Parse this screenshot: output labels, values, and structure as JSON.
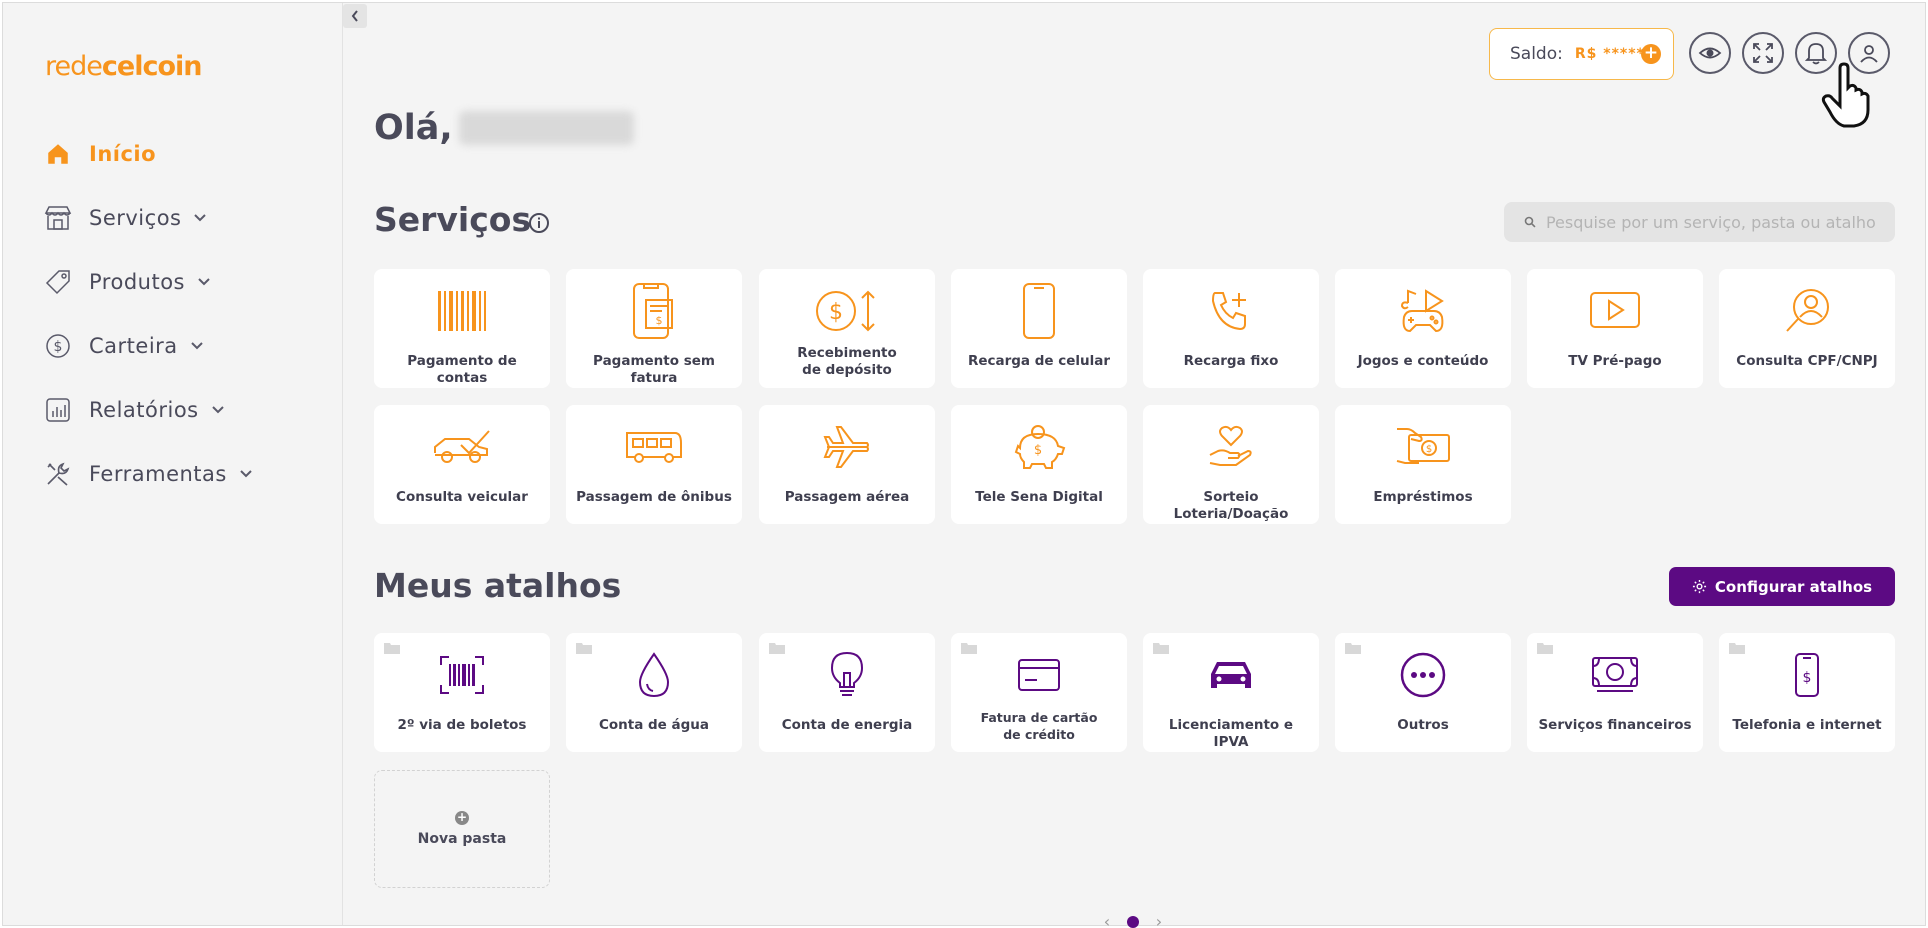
{
  "brand": {
    "logo_part1": "rede",
    "logo_part2": "celcoin",
    "accent": "#f7941d",
    "purple": "#5c0a83"
  },
  "sidebar": {
    "items": [
      {
        "label": "Início",
        "icon": "home-icon",
        "active": true
      },
      {
        "label": "Serviços",
        "icon": "store-icon"
      },
      {
        "label": "Produtos",
        "icon": "tag-icon"
      },
      {
        "label": "Carteira",
        "icon": "dollar-circle-icon"
      },
      {
        "label": "Relatórios",
        "icon": "bar-chart-icon"
      },
      {
        "label": "Ferramentas",
        "icon": "tools-icon"
      }
    ]
  },
  "header": {
    "saldo_label": "Saldo:",
    "saldo_value": "R$ *****",
    "icons": [
      "eye-icon",
      "expand-icon",
      "bell-icon",
      "user-icon"
    ]
  },
  "greeting": "Olá,",
  "services": {
    "title": "Serviços",
    "search_placeholder": "Pesquise por um serviço, pasta ou atalho",
    "items": [
      "Pagamento de contas",
      "Pagamento sem fatura",
      "Recebimento de depósito",
      "Recarga de celular",
      "Recarga fixo",
      "Jogos e conteúdo",
      "TV Pré-pago",
      "Consulta CPF/CNPJ",
      "Consulta veicular",
      "Passagem de ônibus",
      "Passagem aérea",
      "Tele Sena Digital",
      "Sorteio Loteria/Doação",
      "Empréstimos"
    ]
  },
  "shortcuts": {
    "title": "Meus atalhos",
    "config_button": "Configurar atalhos",
    "items": [
      "2º via de boletos",
      "Conta de água",
      "Conta de energia",
      "Fatura de cartão de crédito",
      "Licenciamento e IPVA",
      "Outros",
      "Serviços financeiros",
      "Telefonia e internet"
    ],
    "new_folder": "Nova pasta"
  }
}
